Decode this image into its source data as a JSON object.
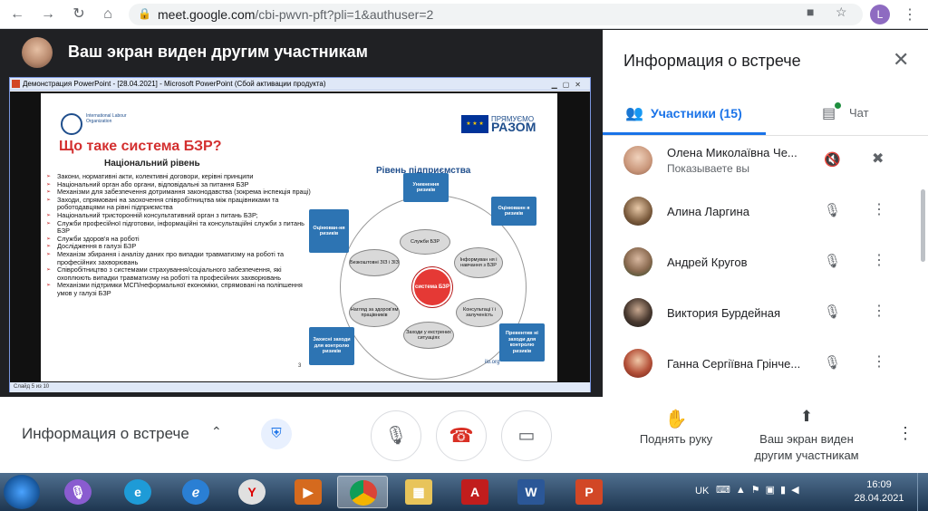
{
  "browser": {
    "url_host": "meet.google.com",
    "url_path": "/cbi-pwvn-pft?pli=1&authuser=2",
    "profile_initial": "L"
  },
  "presenter": {
    "banner": "Ваш экран виден другим участникам"
  },
  "ppt": {
    "window_title": "Демонстрация PowerPoint - [28.04.2021] - Microsoft PowerPoint (Сбой активации продукта)",
    "status": "Слайд 5 из 10"
  },
  "slide": {
    "ilo_text": "International Labour Organization",
    "eu_flag": "★ ★ ★",
    "eu_line1": "ПРЯМУЄМО",
    "eu_line2": "РАЗОМ",
    "title": "Що таке система БЗР?",
    "national_heading": "Національний рівень",
    "enterprise_heading": "Рівень підприємства",
    "bullets": [
      "Закони, нормативні акти, колективні договори, керівні принципи",
      "Національний орган або органи, відповідальні за питання БЗР",
      "Механізми для забезпечення дотримання законодавства (зокрема інспекція праці)",
      "Заходи, спрямовані на заохочення співробітництва між працівниками та роботодавцями на рівні підприємства",
      "Національний тристоронній консультативний орган з питань БЗР;",
      "Служби професійної підготовки, інформаційні та консультаційні служби з питань БЗР",
      "Служби здоров'я на роботі",
      "Дослідження в галузі БЗР",
      "Механізм збирання і аналізу даних про випадки травматизму на роботі та професійних захворювань",
      "Співробітництво з системами страхування/соціального забезпечення, які охоплюють випадки травматизму на роботі та професійних захворювань",
      "Механізми підтримки МСП/неформальної економіки, спрямовані на поліпшення умов у галузі БЗР"
    ],
    "center": "система БЗР",
    "boxes": {
      "top": "Уникнення ризиків",
      "top_right": "Оцінюванн я ризиків",
      "left": "Оцінюван-ня ризиків",
      "bottom_left": "Захисні заходи для контролю ризиків",
      "bottom_right": "Превентив ні заходи для контролю ризиків"
    },
    "ovals": {
      "o1": "Служби БЗР",
      "o2": "Інформуван ня і навчання з БЗР",
      "o3": "Консультаці ї і залученість",
      "o4": "Заходи у екстрених ситуаціях",
      "o5": "Нагляд за здоров'ям працівників",
      "o6": "Безкоштовні ЗІЗ і ЗІЗ"
    },
    "page_number": "3",
    "url": "ilo.org"
  },
  "panel": {
    "title": "Информация о встрече",
    "tab_people": "Участники (15)",
    "tab_chat": "Чат",
    "participants": [
      {
        "name": "Олена Миколаївна Че...",
        "sub": "Показываете вы"
      },
      {
        "name": "Алина Ларгина"
      },
      {
        "name": "Андрей Кругов"
      },
      {
        "name": "Виктория Бурдейная"
      },
      {
        "name": "Ганна Сергіївна Грінче..."
      }
    ]
  },
  "controls": {
    "meeting_details": "Информация о встрече",
    "raise_hand": "Поднять руку",
    "present_now": "Ваш экран виден другим участникам"
  },
  "taskbar": {
    "lang": "UK",
    "time": "16:09",
    "date": "28.04.2021"
  }
}
